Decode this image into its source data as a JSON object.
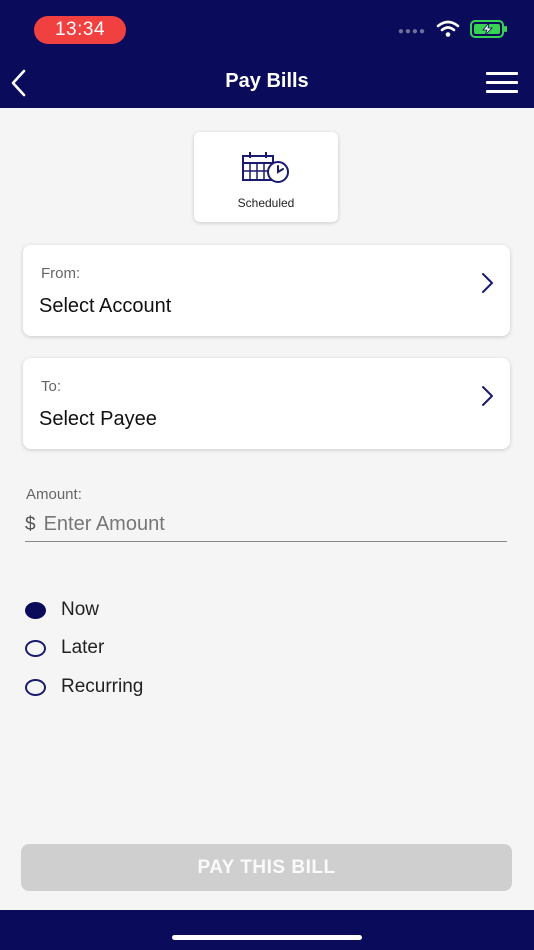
{
  "status_bar": {
    "time": "13:34",
    "signal_icon": "signal-dots-icon",
    "wifi_icon": "wifi-icon",
    "battery_icon": "battery-charging-icon",
    "battery_color": "#39d353"
  },
  "header": {
    "title": "Pay Bills",
    "back_icon": "chevron-left-icon",
    "menu_icon": "hamburger-menu-icon",
    "background": "#0b0b5c"
  },
  "scheduled": {
    "label": "Scheduled",
    "icon": "calendar-clock-icon"
  },
  "from": {
    "label": "From:",
    "value": "Select Account",
    "icon": "chevron-right-icon"
  },
  "to": {
    "label": "To:",
    "value": "Select Payee",
    "icon": "chevron-right-icon"
  },
  "amount": {
    "label": "Amount:",
    "currency": "$",
    "value": "",
    "placeholder": "Enter Amount"
  },
  "timing_options": [
    {
      "label": "Now",
      "selected": true
    },
    {
      "label": "Later",
      "selected": false
    },
    {
      "label": "Recurring",
      "selected": false
    }
  ],
  "pay_button": {
    "label": "PAY THIS BILL",
    "disabled": true
  }
}
